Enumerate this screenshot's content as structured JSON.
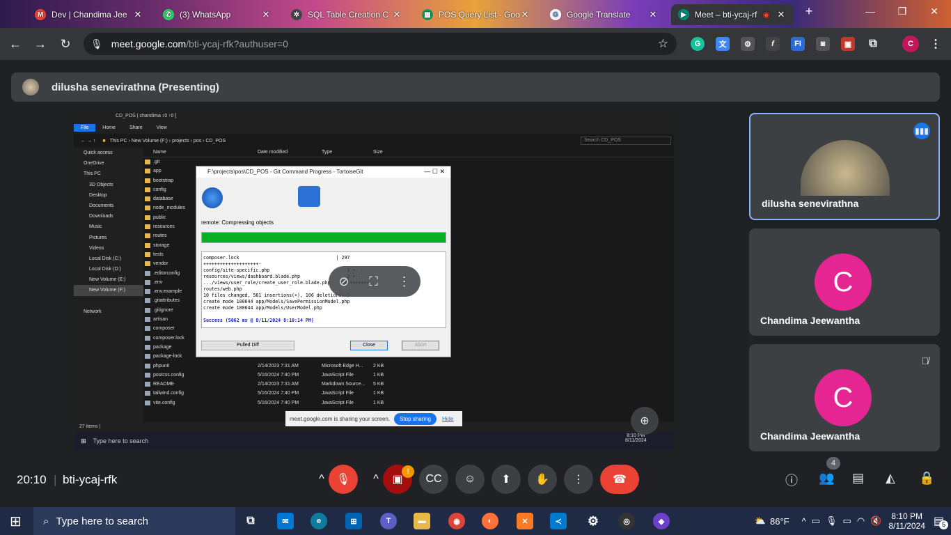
{
  "tabs": [
    {
      "title": "Dev | Chandima Jee",
      "icon": "gmail-icon",
      "color": "#ea4335",
      "glyph": "M"
    },
    {
      "title": "(3) WhatsApp",
      "icon": "whatsapp-icon",
      "color": "#25d366",
      "glyph": "✆"
    },
    {
      "title": "SQL Table Creation C",
      "icon": "openai-icon",
      "color": "#444",
      "glyph": "✲"
    },
    {
      "title": "POS Query List - Goo",
      "icon": "sheets-icon",
      "color": "#0f9d58",
      "glyph": "▦"
    },
    {
      "title": "Google Translate",
      "icon": "google-icon",
      "color": "#fff",
      "glyph": "G"
    },
    {
      "title": "Meet – bti-ycaj-rf",
      "icon": "meet-icon",
      "color": "#00897b",
      "glyph": "▶"
    }
  ],
  "url": {
    "host": "meet.google.com",
    "path": "/bti-ycaj-rfk?authuser=0"
  },
  "presenter_banner": "dilusha senevirathna (Presenting)",
  "explorer": {
    "title": "CD_POS | chandima ↕0 ↑0 ]",
    "ribbon": [
      "File",
      "Home",
      "Share",
      "View"
    ],
    "path": "This PC › New Volume (F:) › projects › pos › CD_POS",
    "search": "Search CD_POS",
    "nav": [
      "Quick access",
      "OneDrive",
      "This PC",
      "3D Objects",
      "Desktop",
      "Documents",
      "Downloads",
      "Music",
      "Pictures",
      "Videos",
      "Local Disk (C:)",
      "Local Disk (D:)",
      "New Volume (E:)",
      "New Volume (F:)",
      "",
      "Network"
    ],
    "headers": [
      "Name",
      "Date modified",
      "Type",
      "Size"
    ],
    "rows": [
      [
        ".git",
        "",
        "",
        ""
      ],
      [
        "app",
        "",
        "",
        ""
      ],
      [
        "bootstrap",
        "",
        "",
        ""
      ],
      [
        "config",
        "",
        "",
        ""
      ],
      [
        "database",
        "",
        "",
        ""
      ],
      [
        "node_modules",
        "",
        "",
        ""
      ],
      [
        "public",
        "",
        "",
        ""
      ],
      [
        "resources",
        "",
        "",
        ""
      ],
      [
        "routes",
        "",
        "",
        ""
      ],
      [
        "storage",
        "",
        "",
        ""
      ],
      [
        "tests",
        "",
        "",
        ""
      ],
      [
        "vendor",
        "",
        "",
        ""
      ],
      [
        ".editorconfig",
        "",
        "",
        ""
      ],
      [
        ".env",
        "",
        "",
        ""
      ],
      [
        ".env.example",
        "",
        "",
        ""
      ],
      [
        ".gitattributes",
        "",
        "",
        ""
      ],
      [
        ".gitignore",
        "",
        "",
        ""
      ],
      [
        "artisan",
        "",
        "",
        ""
      ],
      [
        "composer",
        "",
        "",
        ""
      ],
      [
        "composer.lock",
        "",
        "",
        ""
      ],
      [
        "package",
        "",
        "",
        ""
      ],
      [
        "package-lock",
        "8/8/2024 9:46 PM",
        "JSON Source File",
        "86 KB"
      ],
      [
        "phpunit",
        "2/14/2023 7:31 AM",
        "Microsoft Edge H...",
        "2 KB"
      ],
      [
        "postcss.config",
        "5/16/2024 7:40 PM",
        "JavaScript File",
        "1 KB"
      ],
      [
        "README",
        "2/14/2023 7:31 AM",
        "Markdown Source...",
        "5 KB"
      ],
      [
        "tailwind.config",
        "5/16/2024 7:40 PM",
        "JavaScript File",
        "1 KB"
      ],
      [
        "vite.config",
        "5/16/2024 7:40 PM",
        "JavaScript File",
        "1 KB"
      ]
    ],
    "status": "27 items |",
    "taskbar_search": "Type here to search",
    "time": "8:10 PM",
    "date": "8/11/2024"
  },
  "git": {
    "title": "F:\\projects\\pos\\CD_POS - Git Command Progress - TortoiseGit",
    "status": "remote: Compressing objects",
    "log": "composer.lock                                   | 297\n++++++++++++++++++++-\nconfig/site-specific.php                            2 +-\nresources/views/dashboard.blade.php                 2 +--\n.../views/user_role/create_user_role.blade.php   130 +++++++--\nroutes/web.php\n10 files changed, 581 insertions(+), 106 deletions(-)\ncreate mode 100644 app/Models/SavePermissionModel.php\ncreate mode 100644 app/Models/UserModel.php",
    "success": "Success (5062 ms @ 8/11/2024 8:10:14 PM)",
    "combo": "Pulled Diff",
    "close": "Close",
    "abort": "Abort"
  },
  "share_notice": {
    "text": "meet.google.com is sharing your screen.",
    "stop": "Stop sharing",
    "hide": "Hide"
  },
  "participants": [
    {
      "name": "dilusha senevirathna"
    },
    {
      "name": "Chandima Jeewantha",
      "letter": "C"
    },
    {
      "name": "Chandima Jeewantha",
      "letter": "C"
    }
  ],
  "meeting": {
    "time": "20:10",
    "code": "bti-ycaj-rfk",
    "people_count": "4"
  },
  "windows": {
    "search": "Type here to search",
    "weather": "86°F",
    "time": "8:10 PM",
    "date": "8/11/2024",
    "notif": "5"
  }
}
